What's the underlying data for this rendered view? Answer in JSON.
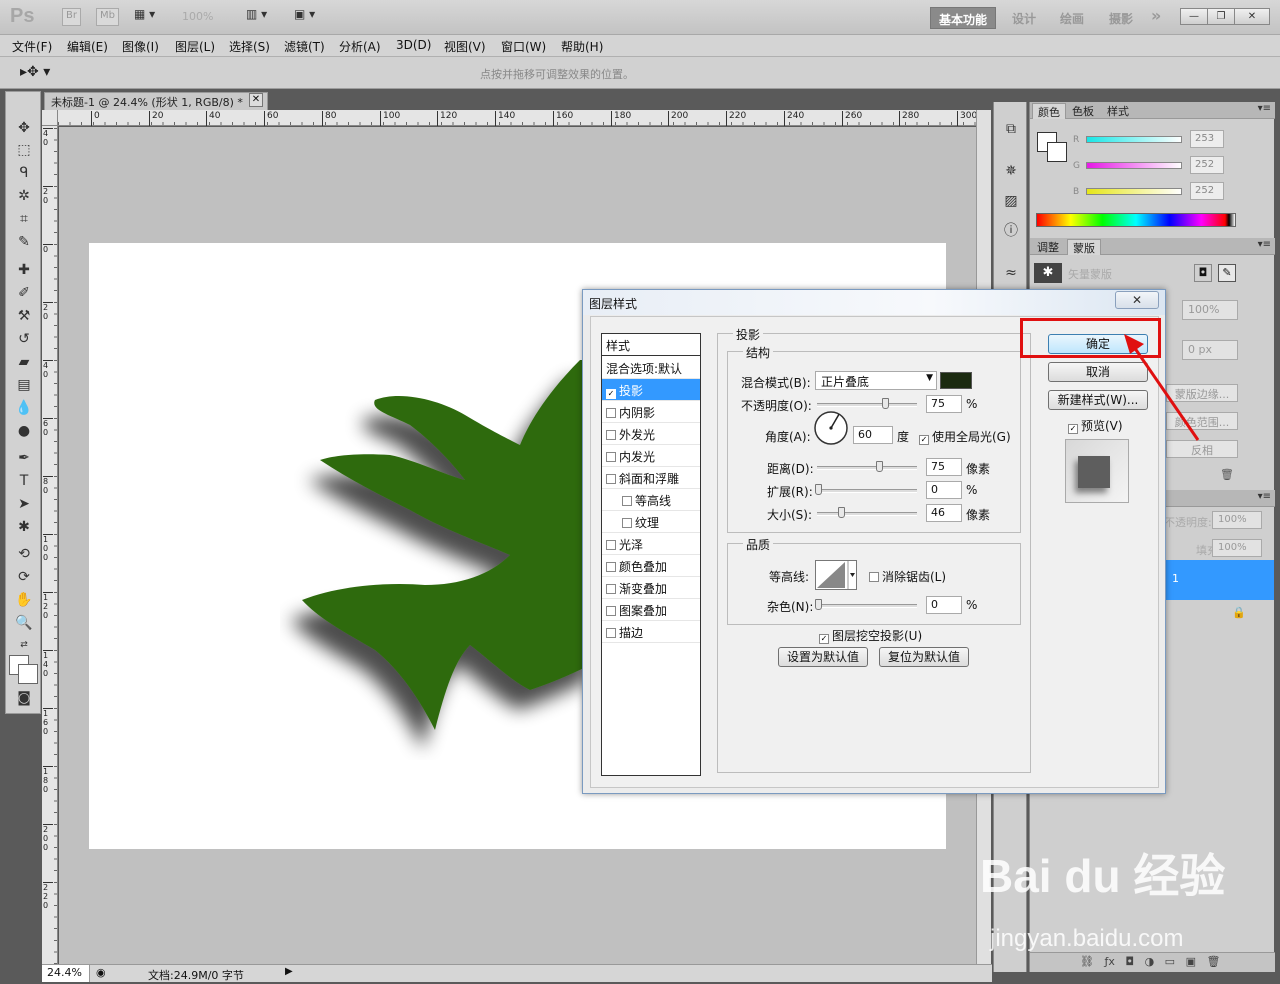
{
  "app": {
    "logo": "Ps",
    "zoom_indicator": "100%"
  },
  "titlebar": {
    "bridge": "Br",
    "minibridge": "Mb",
    "workspaces": [
      "基本功能",
      "设计",
      "绘画",
      "摄影"
    ],
    "more": "»",
    "win_min": "—",
    "win_max": "❐",
    "win_close": "✕"
  },
  "menu": [
    "文件(F)",
    "编辑(E)",
    "图像(I)",
    "图层(L)",
    "选择(S)",
    "滤镜(T)",
    "分析(A)",
    "3D(D)",
    "视图(V)",
    "窗口(W)",
    "帮助(H)"
  ],
  "options_bar": {
    "tool": "▸✥ ▾",
    "hint": "点按并拖移可调整效果的位置。"
  },
  "document": {
    "tab_title": "未标题-1 @ 24.4% (形状 1, RGB/8) *",
    "close": "✕",
    "ruler_top": [
      "0",
      "20",
      "40",
      "60",
      "80",
      "100",
      "120",
      "140",
      "160",
      "180",
      "200",
      "220",
      "240",
      "260",
      "280",
      "300"
    ],
    "ruler_left": [
      "4 0",
      "2 0",
      "0",
      "2 0",
      "4 0",
      "6 0",
      "8 0",
      "1 0 0",
      "1 2 0",
      "1 4 0",
      "1 6 0",
      "1 8 0",
      "2 0 0",
      "2 2 0"
    ],
    "status_zoom": "24.4%",
    "status_doc": "文档:24.9M/0 字节",
    "shape_color": "#2d6a0e"
  },
  "panels": {
    "color": {
      "tabs": [
        "颜色",
        "色板",
        "样式"
      ],
      "channels": [
        {
          "label": "R",
          "value": "253",
          "color": "#19e6e6"
        },
        {
          "label": "G",
          "value": "252",
          "color": "#e619e6"
        },
        {
          "label": "B",
          "value": "252",
          "color": "#e6e619"
        }
      ]
    },
    "masks": {
      "tabs": [
        "调整",
        "蒙版"
      ],
      "vector_mask": "矢量蒙版",
      "density": "100%",
      "feather": "0 px",
      "mask_edge": "蒙版边缘...",
      "color_range": "颜色范围...",
      "invert": "反相"
    },
    "layers": {
      "opacity_label": "不透明度:",
      "opacity": "100%",
      "fill_label": "填充:",
      "fill": "100%",
      "selected_layer": "1"
    }
  },
  "dialog": {
    "title": "图层样式",
    "close": "✕",
    "styles_header": "样式",
    "styles": [
      {
        "label": "混合选项:默认",
        "checkbox": false,
        "checked": false
      },
      {
        "label": "投影",
        "checkbox": true,
        "checked": true,
        "selected": true
      },
      {
        "label": "内阴影",
        "checkbox": true,
        "checked": false
      },
      {
        "label": "外发光",
        "checkbox": true,
        "checked": false
      },
      {
        "label": "内发光",
        "checkbox": true,
        "checked": false
      },
      {
        "label": "斜面和浮雕",
        "checkbox": true,
        "checked": false
      },
      {
        "label": "等高线",
        "checkbox": true,
        "checked": false,
        "indent": true
      },
      {
        "label": "纹理",
        "checkbox": true,
        "checked": false,
        "indent": true
      },
      {
        "label": "光泽",
        "checkbox": true,
        "checked": false
      },
      {
        "label": "颜色叠加",
        "checkbox": true,
        "checked": false
      },
      {
        "label": "渐变叠加",
        "checkbox": true,
        "checked": false
      },
      {
        "label": "图案叠加",
        "checkbox": true,
        "checked": false
      },
      {
        "label": "描边",
        "checkbox": true,
        "checked": false
      }
    ],
    "drop_shadow": {
      "title": "投影",
      "structure_title": "结构",
      "blend_mode_label": "混合模式(B):",
      "blend_mode": "正片叠底",
      "shadow_color": "#1b2a10",
      "opacity_label": "不透明度(O):",
      "opacity": "75",
      "opacity_unit": "%",
      "opacity_level": 75,
      "angle_label": "角度(A):",
      "angle": "60",
      "angle_unit": "度",
      "global_light_label": "使用全局光(G)",
      "global_light": true,
      "distance_label": "距离(D):",
      "distance": "75",
      "distance_unit": "像素",
      "spread_label": "扩展(R):",
      "spread": "0",
      "spread_unit": "%",
      "size_label": "大小(S):",
      "size": "46",
      "size_unit": "像素",
      "quality_title": "品质",
      "contour_label": "等高线:",
      "antialias_label": "消除锯齿(L)",
      "antialias": false,
      "noise_label": "杂色(N):",
      "noise": "0",
      "noise_unit": "%",
      "knockout_label": "图层挖空投影(U)",
      "knockout": true,
      "make_default": "设置为默认值",
      "reset_default": "复位为默认值"
    },
    "buttons": {
      "ok": "确定",
      "cancel": "取消",
      "new_style": "新建样式(W)...",
      "preview_label": "预览(V)",
      "preview": true
    }
  },
  "watermark": {
    "brand": "Bai du 经验",
    "url": "jingyan.baidu.com"
  }
}
